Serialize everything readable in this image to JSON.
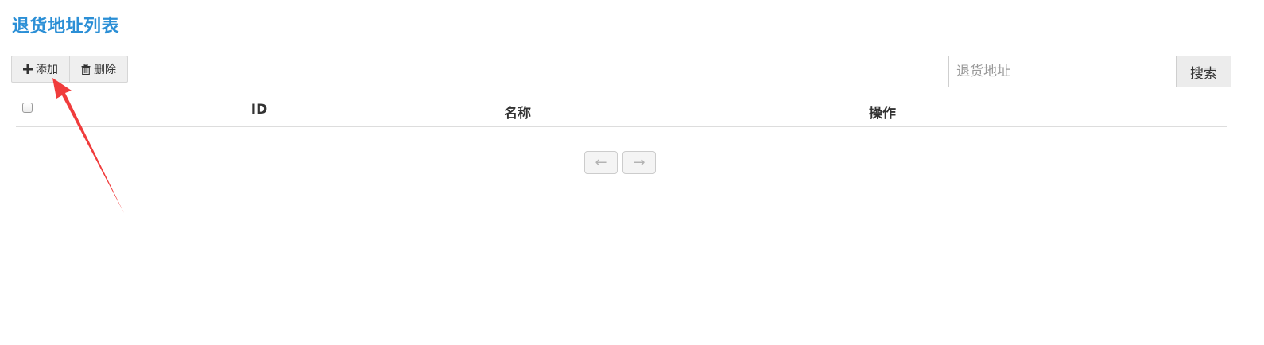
{
  "page": {
    "title": "退货地址列表"
  },
  "toolbar": {
    "add_label": "添加",
    "add_icon": "plus-icon",
    "delete_label": "删除",
    "delete_icon": "trash-icon"
  },
  "search": {
    "placeholder": "退货地址",
    "value": "",
    "button_label": "搜索"
  },
  "table": {
    "columns": [
      "ID",
      "名称",
      "操作"
    ],
    "rows": []
  },
  "pagination": {
    "prev_label": "←",
    "next_label": "→"
  },
  "colors": {
    "title": "#2b8fd6",
    "annotation_arrow": "#f03c3c"
  }
}
